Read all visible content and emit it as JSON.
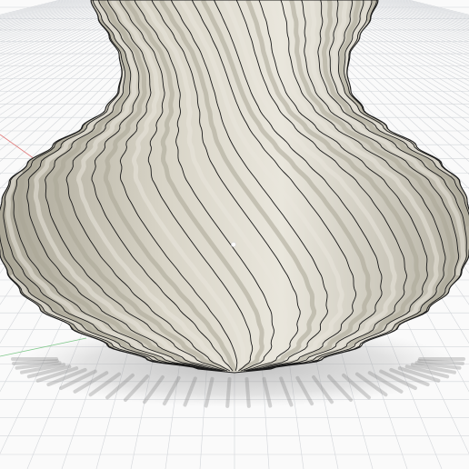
{
  "viewport": {
    "background": "#fafafa",
    "grid_color": "#d3d6da",
    "x_axis_color": "#e07a7a",
    "y_axis_color": "#7fc98a"
  },
  "model": {
    "name": "fluted-vase",
    "surface_color": "#cfcbbd",
    "surface_highlight": "#e9e6dc",
    "surface_shadow": "#a9a596",
    "edge_color": "#1a1a1a",
    "rib_count": 40,
    "twist_direction": "left"
  },
  "pivot_marker": {
    "visible": true
  }
}
